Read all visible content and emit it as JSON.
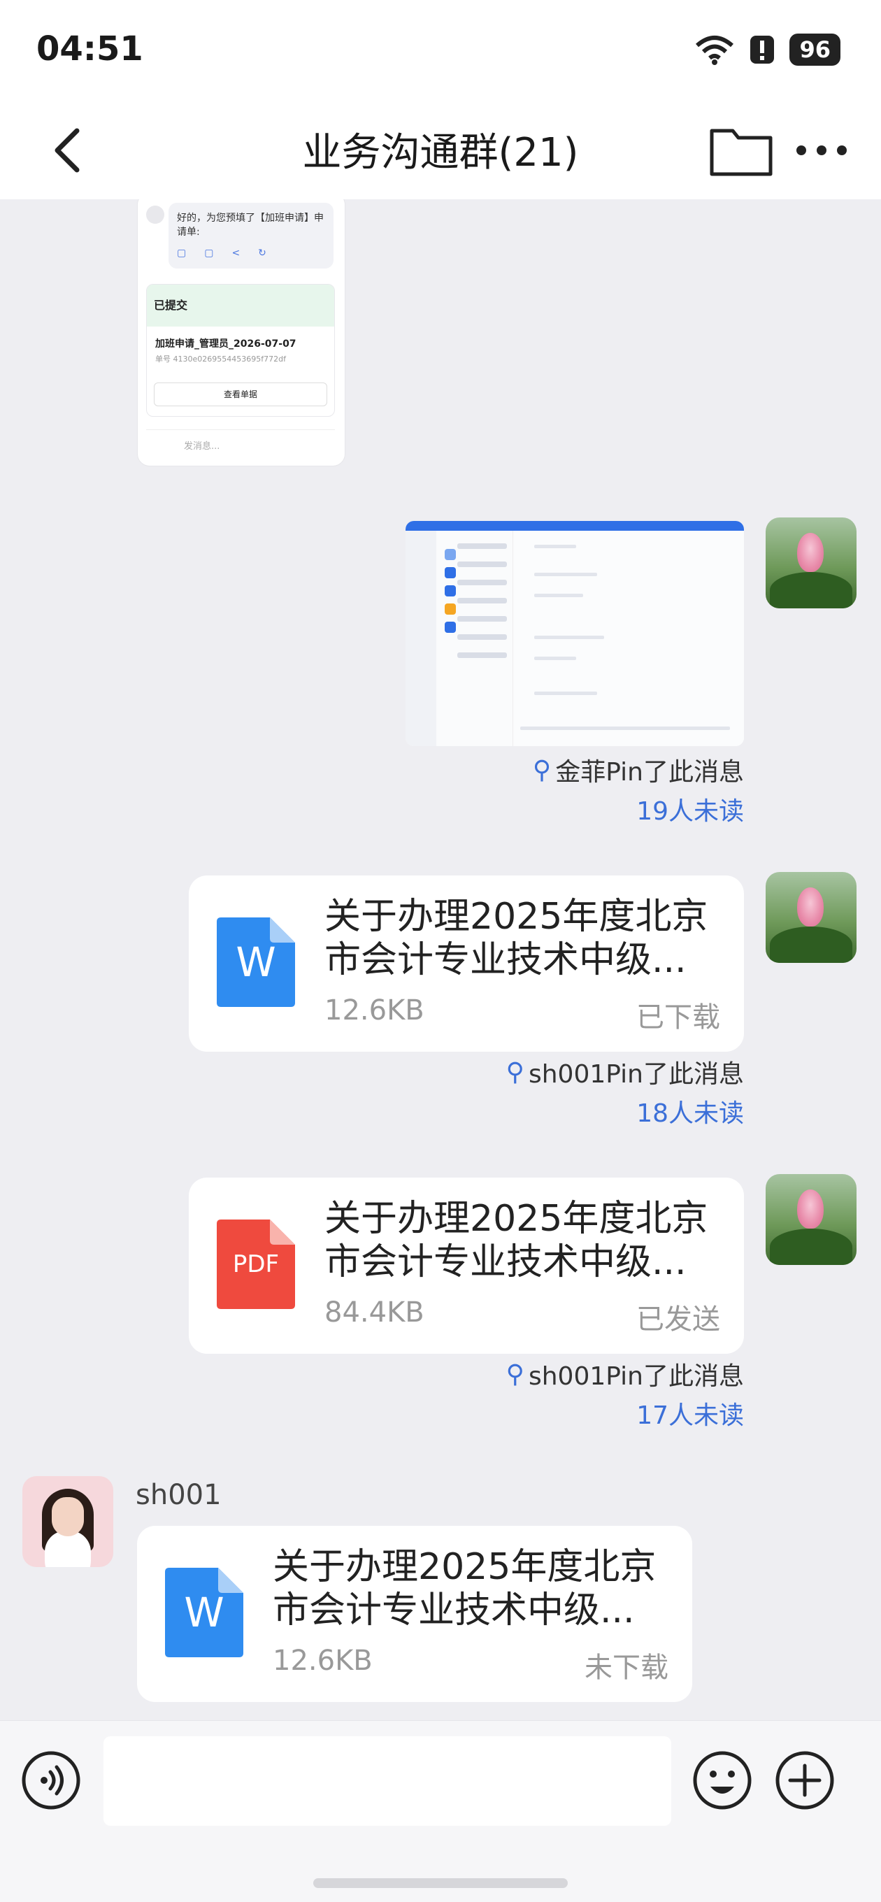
{
  "status_bar": {
    "time": "04:51",
    "battery": "96"
  },
  "header": {
    "title": "业务沟通群(21)"
  },
  "thumb_phone": {
    "bubble_text": "好的，为您预填了【加班申请】申请单:",
    "card_head": "已提交",
    "card_title": "加班申请_管理员_2026-07-07",
    "card_sub": "单号 4130e0269554453695f772df",
    "card_button": "查看单据",
    "input_placeholder": "发消息..."
  },
  "messages": [
    {
      "pin": "金菲Pin了此消息",
      "unread": "19人未读"
    },
    {
      "file_name": "关于办理2025年度北京市会计专业技术中级...",
      "size": "12.6KB",
      "status": "已下载",
      "icon_label": "W",
      "pin": "sh001Pin了此消息",
      "unread": "18人未读"
    },
    {
      "file_name": "关于办理2025年度北京市会计专业技术中级...",
      "size": "84.4KB",
      "status": "已发送",
      "icon_label": "PDF",
      "pin": "sh001Pin了此消息",
      "unread": "17人未读"
    },
    {
      "sender": "sh001",
      "file_name": "关于办理2025年度北京市会计专业技术中级...",
      "size": "12.6KB",
      "status": "未下载",
      "icon_label": "W"
    }
  ],
  "colors": {
    "accent": "#3b6fd8",
    "word": "#2f8cf0",
    "pdf": "#ef4a3e"
  }
}
